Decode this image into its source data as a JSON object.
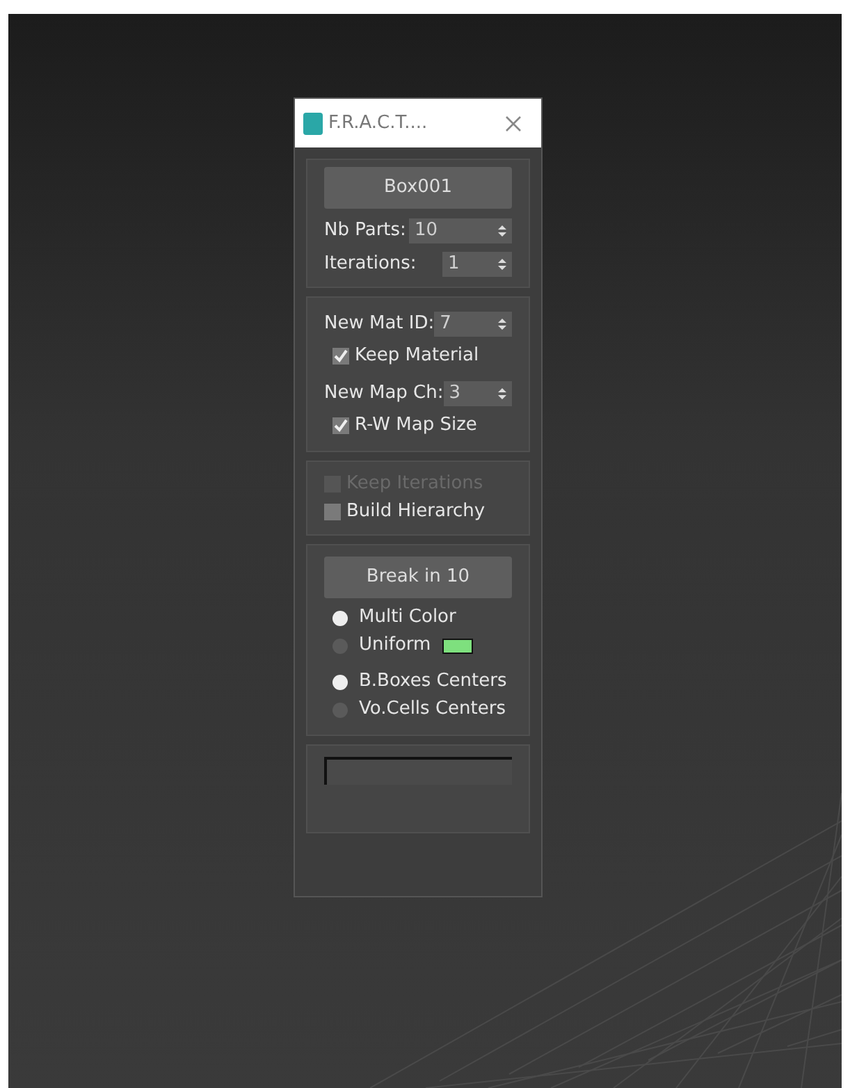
{
  "window": {
    "title": "F.R.A.C.T...."
  },
  "object_button": "Box001",
  "parts": [
    {
      "label": "Nb Parts:",
      "value": "10",
      "kind": "wide"
    },
    {
      "label": "Iterations:",
      "value": "1",
      "kind": "narrow"
    }
  ],
  "material": [
    {
      "kind": "spinner",
      "label": "New Mat ID:",
      "value": "7"
    },
    {
      "kind": "checkbox",
      "label": "Keep Material",
      "checked": true,
      "disabled": false
    },
    {
      "kind": "spinner",
      "label": "New Map Ch:",
      "value": "3"
    },
    {
      "kind": "checkbox",
      "label": "R-W Map Size",
      "checked": true,
      "disabled": false
    }
  ],
  "options": [
    {
      "label": "Keep Iterations",
      "checked": false,
      "disabled": true
    },
    {
      "label": "Build Hierarchy",
      "checked": false,
      "disabled": false
    }
  ],
  "break_button": "Break in 10",
  "color_mode": [
    {
      "label": "Multi Color",
      "selected": true
    },
    {
      "label": "Uniform",
      "selected": false,
      "color": "#7ee07e"
    }
  ],
  "center_mode": [
    {
      "label": "B.Boxes Centers",
      "selected": true
    },
    {
      "label": "Vo.Cells Centers",
      "selected": false
    }
  ]
}
